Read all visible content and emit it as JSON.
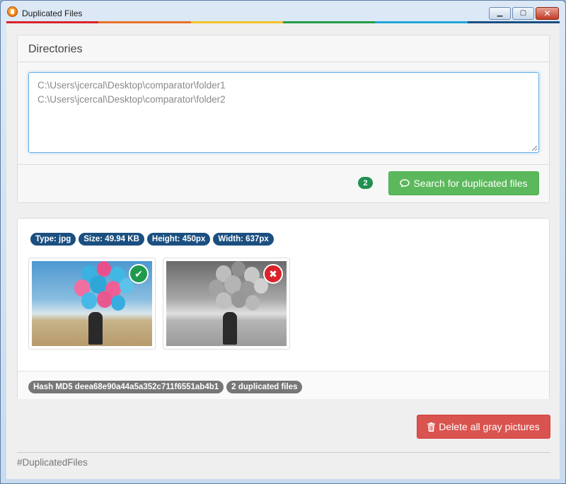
{
  "window": {
    "title": "Duplicated Files",
    "controls": {
      "minimize": "▁",
      "maximize": "▢",
      "close": "✕"
    }
  },
  "accent_stripe": [
    "#d9232b",
    "#e8732a",
    "#f5c12b",
    "#239b49",
    "#23a7d8",
    "#1b4f80"
  ],
  "directories": {
    "heading": "Directories",
    "paths": [
      "C:\\Users\\jcercal\\Desktop\\comparator\\folder1",
      "C:\\Users\\jcercal\\Desktop\\comparator\\folder2"
    ],
    "count_badge": "2",
    "search_button_label": "Search for duplicated files",
    "search_icon": "comment-icon"
  },
  "result": {
    "tags": [
      {
        "label": "Type: jpg"
      },
      {
        "label": "Size: 49.94 KB"
      },
      {
        "label": "Height: 450px"
      },
      {
        "label": "Width: 637px"
      }
    ],
    "images": [
      {
        "variant": "color",
        "status": "keep",
        "status_icon": "check-icon"
      },
      {
        "variant": "gray",
        "status": "delete",
        "status_icon": "times-icon"
      }
    ],
    "hash_label": "Hash MD5 deea68e90a44a5a352c711f6551ab4b1",
    "duplicates_label": "2 duplicated files"
  },
  "actions": {
    "delete_gray_label": "Delete all gray pictures",
    "delete_icon": "trash-icon"
  },
  "footer": {
    "hashtag": "#DuplicatedFiles"
  },
  "colors": {
    "success": "#5cb85c",
    "danger": "#d9534f",
    "primary_badge": "#1b4f80",
    "gray_badge": "#777777",
    "focus_border": "#66afe9"
  }
}
